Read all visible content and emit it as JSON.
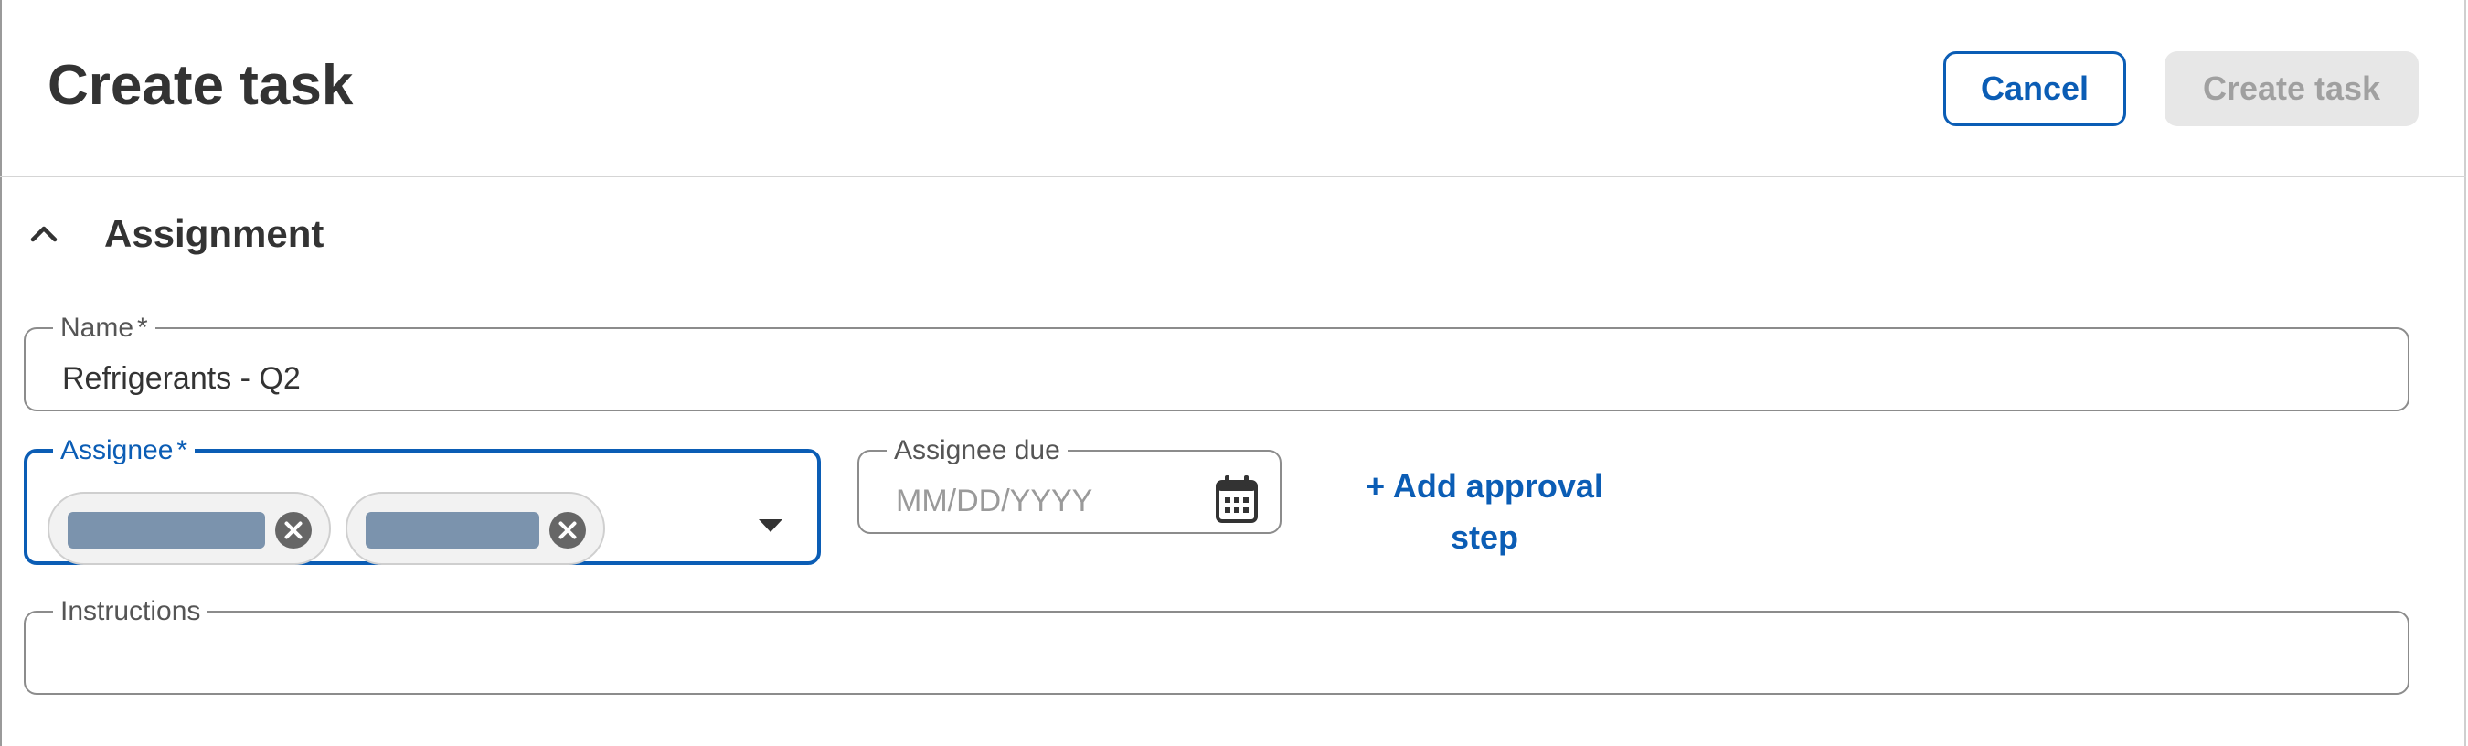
{
  "header": {
    "title": "Create task",
    "cancel_label": "Cancel",
    "create_label": "Create task"
  },
  "section": {
    "title": "Assignment",
    "expanded": true
  },
  "fields": {
    "name": {
      "label": "Name",
      "required_mark": "*",
      "value": "Refrigerants - Q2"
    },
    "assignee": {
      "label": "Assignee",
      "required_mark": "*",
      "chips": [
        {
          "label": ""
        },
        {
          "label": ""
        }
      ]
    },
    "assignee_due": {
      "label": "Assignee due",
      "placeholder": "MM/DD/YYYY",
      "value": ""
    },
    "add_approval_label": "+ Add approval step",
    "instructions": {
      "label": "Instructions",
      "value": ""
    }
  },
  "colors": {
    "accent": "#0b5db5",
    "disabled_bg": "#e7e7e7",
    "disabled_text": "#a0a0a0",
    "chip_redacted": "#7b93ad",
    "border": "#8c8c8c"
  },
  "icons": {
    "section_toggle": "chevron-up-icon",
    "chip_remove": "close-circle-icon",
    "dropdown": "caret-down-icon",
    "date": "calendar-icon"
  }
}
